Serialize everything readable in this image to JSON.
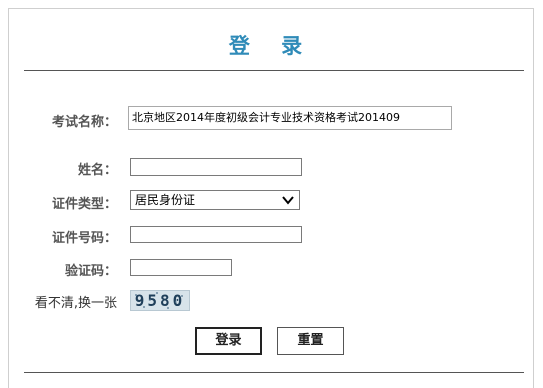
{
  "title": "登 录",
  "form": {
    "exam_name_label": "考试名称：",
    "exam_name_value": "北京地区2014年度初级会计专业技术资格考试201409",
    "name_label": "姓名：",
    "name_value": "",
    "id_type_label": "证件类型：",
    "id_type_selected": "居民身份证",
    "id_number_label": "证件号码：",
    "id_number_value": "",
    "captcha_label": "验证码：",
    "captcha_value": "",
    "refresh_captcha_label": "看不清,换一张",
    "captcha_text": "9580"
  },
  "buttons": {
    "login": "登录",
    "reset": "重置"
  },
  "colors": {
    "title": "#2f8bb8",
    "label": "#555555"
  },
  "icons": {
    "dropdown": "chevron-down-icon"
  }
}
